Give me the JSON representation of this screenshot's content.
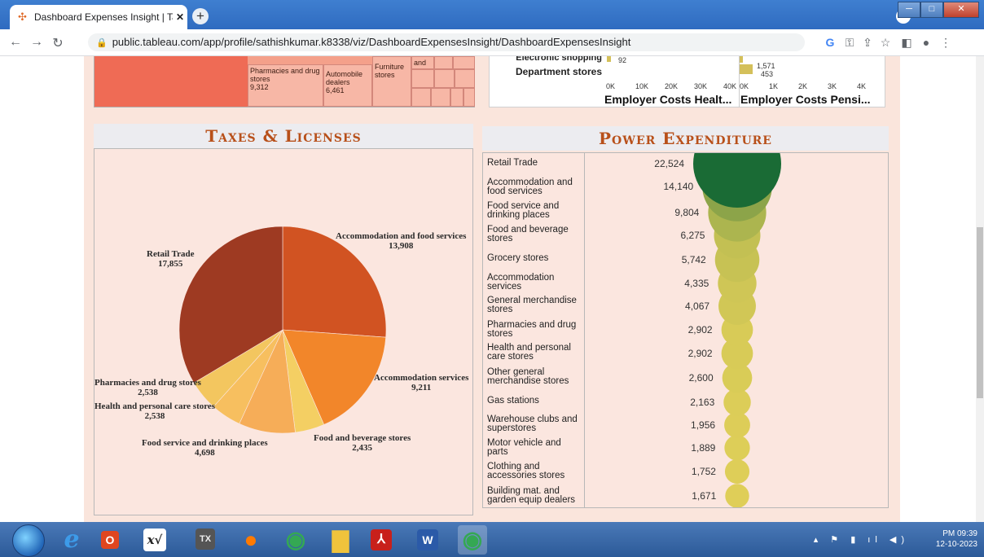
{
  "browser": {
    "tab_title": "Dashboard Expenses Insight | Tab",
    "tab_close": "✕",
    "new_tab": "+",
    "url": "public.tableau.com/app/profile/sathishkumar.k8338/viz/DashboardExpensesInsight/DashboardExpensesInsight"
  },
  "treemap": {
    "cells": [
      {
        "label": "Pharmacies and drug stores",
        "value": "9,312"
      },
      {
        "label": "Automobile dealers",
        "value": "6,461"
      },
      {
        "label": "Furniture stores",
        "value": ""
      },
      {
        "label": "and",
        "value": ""
      }
    ]
  },
  "top_bars": {
    "rows": [
      "Electronic shopping",
      "Department stores"
    ],
    "left_values": [
      "92"
    ],
    "right_values": [
      "1,571",
      "453"
    ],
    "left_ticks": [
      "0K",
      "10K",
      "20K",
      "30K",
      "40K"
    ],
    "right_ticks": [
      "0K",
      "1K",
      "2K",
      "3K",
      "4K"
    ],
    "left_title": "Employer Costs Healt...",
    "right_title": "Employer Costs Pensi...",
    "bar_color": "#d4c05a"
  },
  "taxes": {
    "title": "Taxes & Licenses",
    "slices": [
      {
        "name": "Accommodation and food services",
        "value": 13908,
        "label": "13,908",
        "color": "#d15322"
      },
      {
        "name": "Accommodation services",
        "value": 9211,
        "label": "9,211",
        "color": "#f2862a"
      },
      {
        "name": "Food and beverage stores",
        "value": 2435,
        "label": "2,435",
        "color": "#f4cf63"
      },
      {
        "name": "Food service and drinking places",
        "value": 4698,
        "label": "4,698",
        "color": "#f6ad58"
      },
      {
        "name": "Health and personal care stores",
        "value": 2538,
        "label": "2,538",
        "color": "#f7bf5f"
      },
      {
        "name": "Pharmacies and drug stores",
        "value": 2538,
        "label": "2,538",
        "color": "#f3c65f"
      },
      {
        "name": "Retail Trade",
        "value": 17855,
        "label": "17,855",
        "color": "#9e3a22"
      }
    ]
  },
  "power": {
    "title": "Power Expenditure",
    "rows": [
      {
        "name": "Retail Trade",
        "value": 22524,
        "label": "22,524"
      },
      {
        "name": "Accommodation and food services",
        "value": 14140,
        "label": "14,140"
      },
      {
        "name": "Food service and drinking places",
        "value": 9804,
        "label": "9,804"
      },
      {
        "name": "Food and beverage stores",
        "value": 6275,
        "label": "6,275"
      },
      {
        "name": "Grocery stores",
        "value": 5742,
        "label": "5,742"
      },
      {
        "name": "Accommodation services",
        "value": 4335,
        "label": "4,335"
      },
      {
        "name": "General merchandise stores",
        "value": 4067,
        "label": "4,067"
      },
      {
        "name": "Pharmacies and drug stores",
        "value": 2902,
        "label": "2,902"
      },
      {
        "name": "Health and personal care stores",
        "value": 2902,
        "label": "2,902"
      },
      {
        "name": "Other general merchandise stores",
        "value": 2600,
        "label": "2,600"
      },
      {
        "name": "Gas stations",
        "value": 2163,
        "label": "2,163"
      },
      {
        "name": "Warehouse clubs and superstores",
        "value": 1956,
        "label": "1,956"
      },
      {
        "name": "Motor vehicle and parts",
        "value": 1889,
        "label": "1,889"
      },
      {
        "name": "Clothing and accessories stores",
        "value": 1752,
        "label": "1,752"
      },
      {
        "name": "Building mat. and garden equip dealers",
        "value": 1671,
        "label": "1,671"
      }
    ],
    "color_high": "#1a6b35",
    "color_low": "#e8d35a"
  },
  "taskbar": {
    "time": "PM 09:39",
    "date": "12-10-2023"
  }
}
